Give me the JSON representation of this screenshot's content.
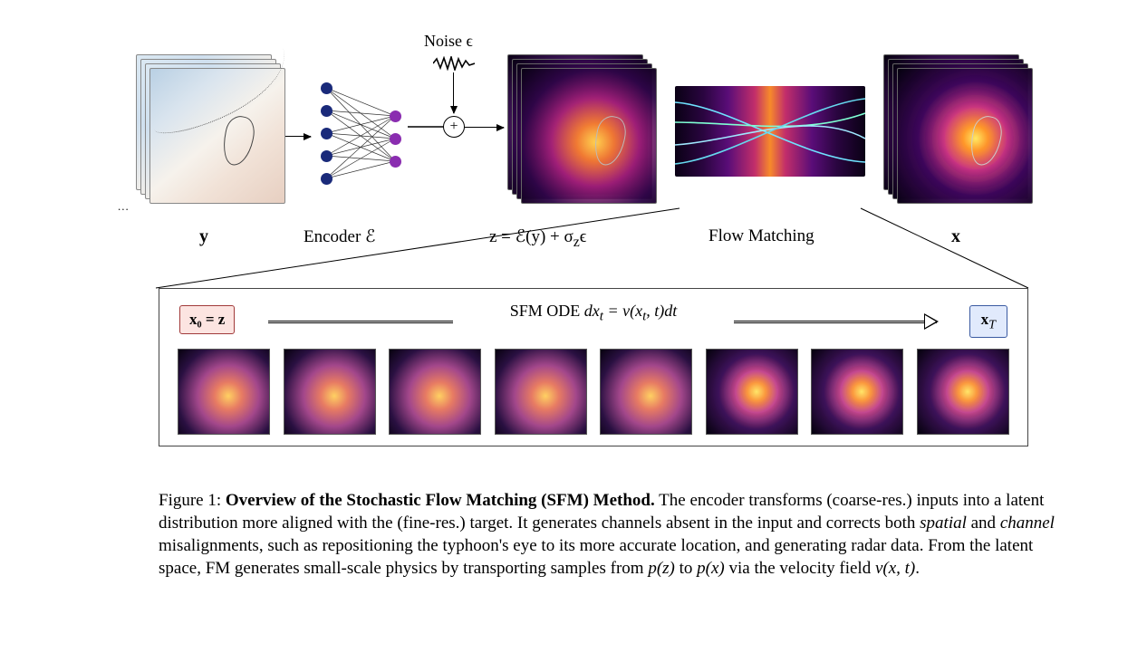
{
  "labels": {
    "y": "y",
    "encoder": "Encoder ℰ",
    "noise": "Noise ϵ",
    "z_eq": "z = ℰ(y) + σ",
    "z_eq_sub": "z",
    "z_eq_tail": "ϵ",
    "flow_matching": "Flow Matching",
    "x": "x",
    "plus": "+",
    "ellipsis": "..."
  },
  "ode": {
    "x0": "x₀ = z",
    "eq_prefix": "SFM ODE  ",
    "eq_main": "dx",
    "eq_sub_t": "t",
    "eq_mid": " = ν(x",
    "eq_mid2": ", t)dt",
    "xT": "x",
    "xT_sub": "T"
  },
  "caption": {
    "lead": "Figure 1:",
    "title": " Overview of the Stochastic Flow Matching (SFM) Method.",
    "body1": " The encoder transforms (coarse-res.) inputs into a latent distribution more aligned with the (fine-res.) target. It generates channels absent in the input and corrects both ",
    "spatial": "spatial",
    "body_and": " and ",
    "channel": "channel",
    "body2": " misalignments, such as repositioning the typhoon's eye to its more accurate location, and generating radar data. From the latent space, FM generates small-scale physics by transporting samples from ",
    "pz": "p(z)",
    "body_to": " to ",
    "px": "p(x)",
    "body_via": " via the velocity field ",
    "nu": "ν(x, t)",
    "body_end": "."
  }
}
